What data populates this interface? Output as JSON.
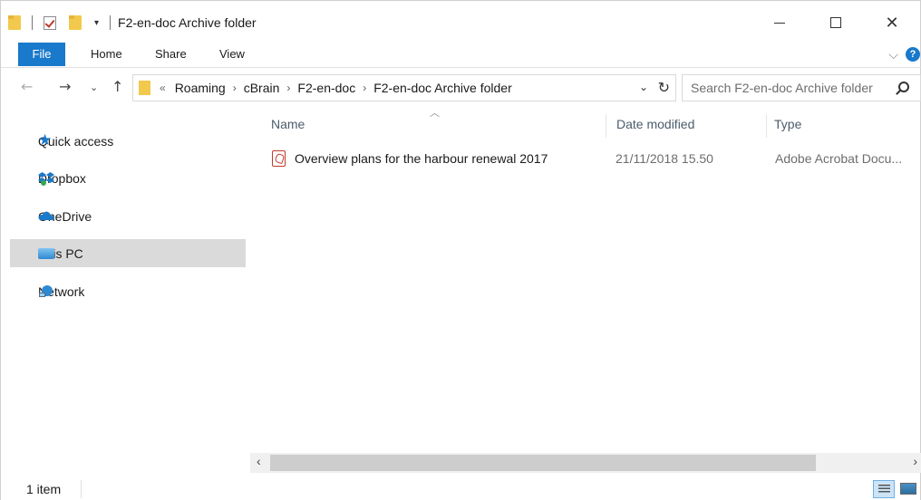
{
  "window": {
    "title": "F2-en-doc Archive folder",
    "qat_dropdown": "▾",
    "minimize": "",
    "maximize": "",
    "close": "✕"
  },
  "ribbon": {
    "tabs": [
      "File",
      "Home",
      "Share",
      "View"
    ],
    "expand": "⌵",
    "help": "?"
  },
  "navigation": {
    "back": "←",
    "forward": "→",
    "recent": "⌄",
    "up": "↑"
  },
  "address": {
    "overflow": "«",
    "breadcrumbs": [
      "Roaming",
      "cBrain",
      "F2-en-doc",
      "F2-en-doc Archive folder"
    ],
    "separator": "›",
    "dropdown": "⌄",
    "refresh": "↻"
  },
  "search": {
    "placeholder": "Search F2-en-doc Archive folder"
  },
  "nav_pane": {
    "items": [
      {
        "label": "Quick access",
        "icon": "star-icon"
      },
      {
        "label": "Dropbox",
        "icon": "dropbox-icon"
      },
      {
        "label": "OneDrive",
        "icon": "onedrive-icon"
      },
      {
        "label": "This PC",
        "icon": "computer-icon",
        "selected": true
      },
      {
        "label": "Network",
        "icon": "network-icon"
      }
    ]
  },
  "content": {
    "sort_indicator": "︿",
    "columns": [
      "Name",
      "Date modified",
      "Type"
    ],
    "files": [
      {
        "name": "Overview plans for the harbour renewal 2017",
        "date_modified": "21/11/2018 15.50",
        "type": "Adobe Acrobat Docu...",
        "icon": "pdf-file-icon"
      }
    ]
  },
  "scrollbar": {
    "left": "‹",
    "right": "›"
  },
  "status": {
    "item_count": "1 item"
  },
  "colors": {
    "accent": "#1979ca",
    "selected_bg": "#dadada",
    "pdf_red": "#c0392b"
  }
}
